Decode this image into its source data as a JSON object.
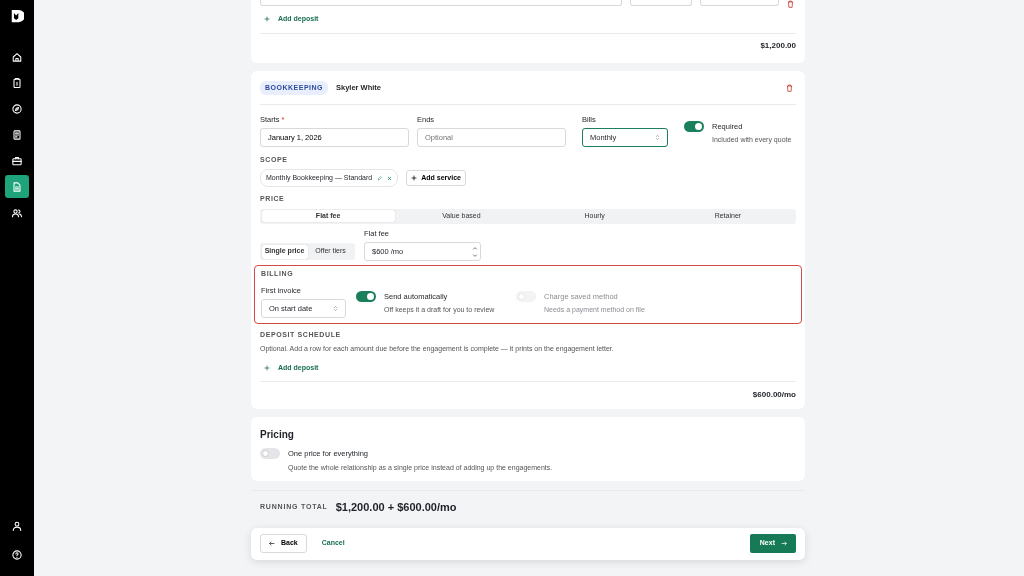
{
  "sidebar": {
    "items": [
      {
        "kind": "home",
        "selected": false
      },
      {
        "kind": "clipboard",
        "selected": false
      },
      {
        "kind": "compass",
        "selected": false
      },
      {
        "kind": "sheet",
        "selected": false
      },
      {
        "kind": "briefcase",
        "selected": false
      },
      {
        "kind": "document",
        "selected": true
      },
      {
        "kind": "people",
        "selected": false
      }
    ],
    "bottom_items": [
      {
        "kind": "user",
        "selected": false
      },
      {
        "kind": "help",
        "selected": false
      }
    ]
  },
  "deposit_card": {
    "add_deposit": "Add deposit",
    "total": "$1,200.00"
  },
  "engagement": {
    "tag": "BOOKKEEPING",
    "client": "Skyler White",
    "fields": [
      {
        "label": "Starts",
        "required_mark": "*",
        "value": "January 1, 2026"
      },
      {
        "label": "Ends",
        "placeholder": "Optional"
      }
    ],
    "bills": {
      "label": "Bills",
      "value": "Monthly"
    },
    "required_toggle": {
      "label": "Required",
      "hint": "Included with every quote",
      "on": true
    },
    "scope": {
      "heading": "SCOPE",
      "services": [
        "Monthly Bookkeeping — Standard"
      ],
      "add": "Add service"
    },
    "price": {
      "heading": "PRICE",
      "tabs": [
        {
          "label": "Flat fee",
          "selected": true
        },
        {
          "label": "Value based",
          "selected": false
        },
        {
          "label": "Hourly",
          "selected": false
        },
        {
          "label": "Retainer",
          "selected": false
        }
      ],
      "modes": [
        {
          "label": "Single price",
          "selected": true
        },
        {
          "label": "Offer tiers",
          "selected": false
        }
      ],
      "fee_label": "Flat fee",
      "fee_value": "$600 /mo"
    },
    "billing": {
      "heading": "BILLING",
      "highlighted": true,
      "first_invoice": {
        "label": "First invoice",
        "value": "On start date"
      },
      "toggles": [
        {
          "label": "Send automatically",
          "hint": "Off keeps it a draft for you to review",
          "on": true,
          "disabled": false
        },
        {
          "label": "Charge saved method",
          "hint": "Needs a payment method on file",
          "on": false,
          "disabled": true
        }
      ]
    },
    "deposit_schedule": {
      "heading": "DEPOSIT SCHEDULE",
      "hint": "Optional. Add a row for each amount due before the engagement is complete — it prints on the engagement letter.",
      "add_deposit": "Add deposit"
    },
    "total": "$600.00/mo"
  },
  "pricing": {
    "title": "Pricing",
    "toggle": {
      "label": "One price for everything",
      "hint": "Quote the whole relationship as a single price instead of adding up the engagements.",
      "on": false
    }
  },
  "running_total": {
    "label": "RUNNING TOTAL",
    "value": "$1,200.00 + $600.00/mo"
  },
  "footer": {
    "back": "Back",
    "cancel": "Cancel",
    "next": "Next"
  }
}
